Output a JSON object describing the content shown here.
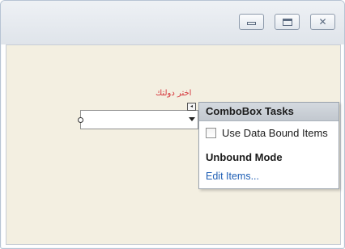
{
  "form": {
    "label_text": "اختر دولتك"
  },
  "window_controls": {
    "minimize_icon": "minimize-icon",
    "maximize_icon": "maximize-icon",
    "close_icon": "close-icon",
    "close_glyph": "✕"
  },
  "combobox": {
    "value": "",
    "smart_tag_glyph": "◂"
  },
  "tasks_panel": {
    "title": "ComboBox Tasks",
    "use_data_bound_label": "Use Data Bound Items",
    "use_data_bound_checked": false,
    "section_title": "Unbound Mode",
    "edit_items_link": "Edit Items..."
  },
  "colors": {
    "label_color": "#d5343a",
    "link_color": "#1f5fb5",
    "form_background": "#f3efe1"
  }
}
